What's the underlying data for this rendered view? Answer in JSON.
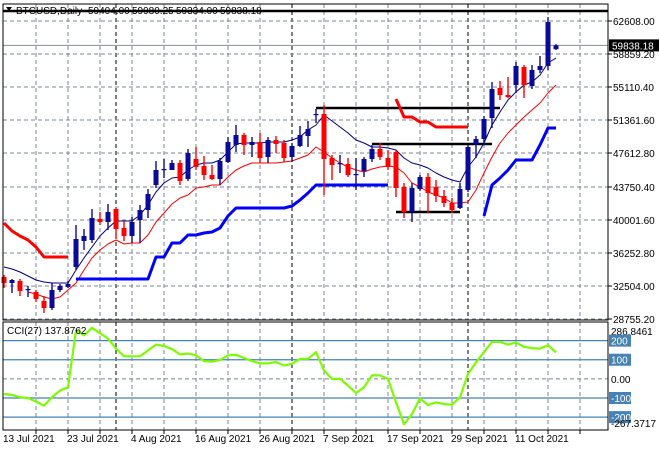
{
  "header": {
    "symbol": "BTCUSD,Daily",
    "open": "59404.00",
    "high": "59980.25",
    "low": "59334.00",
    "close": "59838.18"
  },
  "colors": {
    "bull": "#0a0a9a",
    "bear": "#ff0000",
    "ma_fast": "#000080",
    "ma_slow": "#ff0000",
    "stop_bull": "#0000ff",
    "stop_bear": "#ff0000",
    "cci": "#7cfc00",
    "levels": "#4682b4",
    "grid": "#7a8794",
    "hline": "#000000"
  },
  "chart_data": {
    "type": "candlestick",
    "title": "BTCUSD,Daily",
    "ylim": [
      28642,
      64540
    ],
    "price_ticks": [
      {
        "value": 62608.0,
        "label": "62608.00"
      },
      {
        "value": 58859.2,
        "label": "58859.20"
      },
      {
        "value": 55110.4,
        "label": "55110.40"
      },
      {
        "value": 51361.6,
        "label": "51361.60"
      },
      {
        "value": 47612.8,
        "label": "47612.80"
      },
      {
        "value": 43750.4,
        "label": "43750.40"
      },
      {
        "value": 40001.6,
        "label": "40001.60"
      },
      {
        "value": 36252.8,
        "label": "36252.80"
      },
      {
        "value": 32504.0,
        "label": "32504.00"
      },
      {
        "value": 28755.2,
        "label": "28755.20"
      }
    ],
    "current_price": {
      "value": 59838.18,
      "label": "59838.18"
    },
    "x_ticks": [
      {
        "bar": 0,
        "label": "13 Jul 2021"
      },
      {
        "bar": 8,
        "label": "23 Jul 2021"
      },
      {
        "bar": 16,
        "label": "4 Aug 2021"
      },
      {
        "bar": 24,
        "label": "16 Aug 2021"
      },
      {
        "bar": 32,
        "label": "26 Aug 2021"
      },
      {
        "bar": 40,
        "label": "7 Sep 2021"
      },
      {
        "bar": 48,
        "label": "17 Sep 2021"
      },
      {
        "bar": 56,
        "label": "29 Sep 2021"
      },
      {
        "bar": 64,
        "label": "11 Oct 2021"
      }
    ],
    "month_separators": [
      14,
      36,
      58
    ],
    "ohlc": [
      [
        33527,
        33754,
        32277,
        32845
      ],
      [
        32845,
        33300,
        31709,
        33186
      ],
      [
        33072,
        33300,
        31368,
        31936
      ],
      [
        32050,
        32504,
        31255,
        32164
      ],
      [
        31823,
        32050,
        30687,
        31028
      ],
      [
        30800,
        31368,
        29437,
        30005
      ],
      [
        30005,
        32845,
        29778,
        32050
      ],
      [
        32050,
        32732,
        31823,
        32504
      ],
      [
        32391,
        33072,
        32277,
        32732
      ],
      [
        34663,
        39434,
        34322,
        37844
      ],
      [
        37616,
        38980,
        36594,
        38184
      ],
      [
        37730,
        41252,
        37389,
        40229
      ],
      [
        40116,
        40911,
        39434,
        39775
      ],
      [
        39775,
        41820,
        38866,
        40911
      ],
      [
        41252,
        41479,
        37844,
        38980
      ],
      [
        39093,
        39888,
        37616,
        38184
      ],
      [
        38184,
        40343,
        37389,
        39775
      ],
      [
        40002,
        41706,
        37389,
        41138
      ],
      [
        41138,
        43524,
        40229,
        42956
      ],
      [
        43978,
        46704,
        43637,
        45682
      ],
      [
        45682,
        46932,
        44773,
        45796
      ],
      [
        45682,
        46818,
        45682,
        46477
      ],
      [
        46477,
        46818,
        43978,
        44432
      ],
      [
        44660,
        48068,
        44432,
        47613
      ],
      [
        46932,
        48295,
        45682,
        46023
      ],
      [
        46136,
        47273,
        44546,
        45114
      ],
      [
        45114,
        46250,
        44546,
        44660
      ],
      [
        44660,
        47045,
        43978,
        46704
      ],
      [
        46591,
        49431,
        46477,
        48863
      ],
      [
        48522,
        50794,
        47727,
        49658
      ],
      [
        49658,
        49885,
        47386,
        48522
      ],
      [
        48522,
        49431,
        47159,
        48863
      ],
      [
        48863,
        49885,
        46477,
        47045
      ],
      [
        47159,
        49431,
        46477,
        49090
      ],
      [
        49090,
        49544,
        47613,
        48636
      ],
      [
        48749,
        49090,
        46591,
        47045
      ],
      [
        47159,
        48749,
        46591,
        48408
      ],
      [
        48408,
        50680,
        48295,
        49658
      ],
      [
        49544,
        51248,
        48295,
        50340
      ],
      [
        51930,
        52612,
        51021,
        52044
      ],
      [
        52044,
        53066,
        42842,
        46932
      ],
      [
        47045,
        47386,
        44546,
        46250
      ],
      [
        46364,
        47386,
        45341,
        46477
      ],
      [
        46364,
        47045,
        44887,
        45114
      ],
      [
        45114,
        47045,
        43410,
        45228
      ],
      [
        45568,
        47159,
        44887,
        46932
      ],
      [
        46932,
        48522,
        46591,
        48068
      ],
      [
        48068,
        48749,
        46818,
        47159
      ],
      [
        47045,
        47954,
        45682,
        46023
      ],
      [
        47727,
        47954,
        42615,
        43637
      ],
      [
        43751,
        44205,
        40229,
        40911
      ],
      [
        40911,
        44205,
        39775,
        43637
      ],
      [
        43524,
        45114,
        43296,
        44887
      ],
      [
        44887,
        45341,
        40797,
        43070
      ],
      [
        43751,
        44546,
        42047,
        42728
      ],
      [
        42728,
        43410,
        41479,
        41933
      ],
      [
        41933,
        42501,
        40797,
        41138
      ],
      [
        41365,
        44205,
        41252,
        43524
      ],
      [
        43410,
        48522,
        43183,
        48295
      ],
      [
        48636,
        49544,
        47045,
        49204
      ],
      [
        49204,
        51816,
        48522,
        51476
      ],
      [
        51589,
        55679,
        50453,
        54884
      ],
      [
        54997,
        55792,
        53634,
        54202
      ],
      [
        54202,
        56247,
        53861,
        53975
      ],
      [
        55338,
        57951,
        54429,
        57496
      ],
      [
        57383,
        57610,
        53861,
        55338
      ],
      [
        55224,
        57610,
        54884,
        57042
      ],
      [
        57042,
        58632,
        56701,
        57496
      ],
      [
        57496,
        63063,
        57042,
        62495
      ],
      [
        59404,
        59980.25,
        59334,
        59838.18
      ]
    ],
    "overlays": {
      "ma_fast": [
        34660,
        34440,
        34100,
        33640,
        33190,
        32960,
        32850,
        32850,
        32850,
        34320,
        35690,
        36940,
        38180,
        39090,
        39890,
        39890,
        39890,
        40570,
        41710,
        43180,
        44210,
        44770,
        44890,
        45680,
        46250,
        46480,
        46480,
        46820,
        47730,
        48640,
        48750,
        48750,
        48750,
        48860,
        48860,
        48860,
        49090,
        49430,
        50230,
        50790,
        51930,
        51250,
        50570,
        49890,
        49090,
        48750,
        48300,
        48300,
        48180,
        47950,
        47050,
        46480,
        46250,
        45910,
        45340,
        44890,
        44550,
        44320,
        46020,
        47160,
        48750,
        50790,
        52270,
        53630,
        54540,
        55340,
        55680,
        56470,
        57840,
        58410
      ],
      "ma_slow": [
        null,
        null,
        null,
        31820,
        31600,
        31260,
        31030,
        31260,
        32050,
        32850,
        34320,
        35690,
        36590,
        37280,
        37730,
        37280,
        37390,
        37390,
        38300,
        39780,
        40800,
        41820,
        42500,
        42840,
        43640,
        43750,
        43980,
        43980,
        44890,
        45680,
        46140,
        46480,
        46480,
        46480,
        46480,
        46590,
        46700,
        47050,
        47390,
        48300,
        47730,
        47050,
        46480,
        46020,
        45680,
        45460,
        45800,
        46020,
        46140,
        46020,
        45340,
        44210,
        43750,
        43180,
        42840,
        42500,
        41930,
        41930,
        42050,
        43410,
        45340,
        47160,
        48750,
        49890,
        50790,
        51700,
        52500,
        53290,
        54430,
        55340
      ],
      "stop_bear": [
        39660,
        38750,
        38180,
        37730,
        36940,
        35800,
        35800,
        35800,
        35800,
        null,
        null,
        null,
        null,
        null,
        null,
        null,
        null,
        null,
        null,
        null,
        null,
        null,
        null,
        null,
        null,
        null,
        null,
        null,
        null,
        null,
        null,
        null,
        null,
        null,
        null,
        null,
        null,
        null,
        null,
        null,
        null,
        null,
        null,
        null,
        null,
        null,
        null,
        null,
        null,
        53750,
        51700,
        51700,
        51140,
        51140,
        50570,
        50570,
        50570,
        50570,
        50570,
        null,
        null,
        null,
        null,
        null,
        null,
        null,
        null,
        null,
        null,
        null
      ],
      "stop_bull": [
        null,
        null,
        null,
        null,
        null,
        null,
        null,
        null,
        null,
        33300,
        33300,
        33300,
        33300,
        33300,
        33300,
        33300,
        33300,
        33300,
        33300,
        35800,
        35800,
        37390,
        37390,
        38300,
        38300,
        38530,
        38640,
        39090,
        40460,
        41370,
        41370,
        41370,
        41370,
        41370,
        41370,
        41370,
        41590,
        42270,
        43070,
        43980,
        43980,
        43980,
        43980,
        43980,
        43980,
        43980,
        43980,
        43980,
        43980,
        null,
        null,
        null,
        null,
        null,
        null,
        null,
        null,
        null,
        null,
        null,
        40460,
        43980,
        44770,
        45680,
        46820,
        46820,
        46820,
        48520,
        50450,
        50450
      ]
    },
    "hlines": [
      {
        "price": 63744,
        "from_bar": -1,
        "to_bar": 76
      },
      {
        "price": 52725,
        "from_bar": 39,
        "to_bar": 62
      },
      {
        "price": 48636,
        "from_bar": 46,
        "to_bar": 61
      },
      {
        "price": 40911,
        "from_bar": 49,
        "to_bar": 57
      }
    ],
    "cci": {
      "label": "CCI(27) 137.8762",
      "ylim": [
        -267.3717,
        286.8461
      ],
      "levels": [
        200,
        100,
        -100,
        -200
      ],
      "tick_labels": [
        {
          "value": 286.8461,
          "label": "286.8461",
          "boxed": false
        },
        {
          "value": 200,
          "label": "200",
          "boxed": true
        },
        {
          "value": 100,
          "label": "100",
          "boxed": true
        },
        {
          "value": 0,
          "label": "0.00",
          "boxed": false
        },
        {
          "value": -100,
          "label": "-100",
          "boxed": true
        },
        {
          "value": -200,
          "label": "-200",
          "boxed": true
        },
        {
          "value": -267.3717,
          "label": "-267.3717",
          "boxed": false
        }
      ],
      "values": [
        -79,
        -84,
        -96,
        -100,
        -119,
        -140,
        -96,
        -61,
        -44,
        255,
        228,
        267,
        238,
        211,
        158,
        118,
        118,
        118,
        149,
        179,
        172,
        155,
        128,
        132,
        123,
        93,
        90,
        98,
        123,
        126,
        109,
        93,
        81,
        81,
        88,
        70,
        79,
        105,
        105,
        140,
        44,
        0,
        0,
        -35,
        -74,
        -44,
        18,
        18,
        0,
        -123,
        -237,
        -184,
        -102,
        -137,
        -123,
        -132,
        -135,
        -96,
        26,
        86,
        140,
        193,
        193,
        179,
        190,
        167,
        161,
        158,
        176,
        137.8762
      ]
    }
  }
}
